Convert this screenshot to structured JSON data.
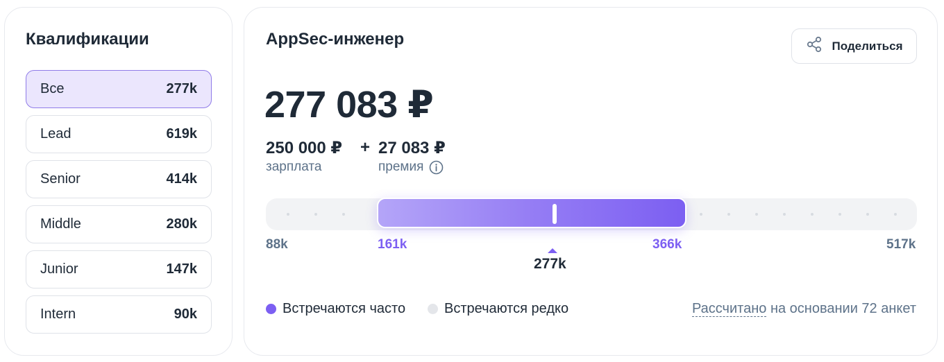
{
  "qualifications": {
    "title": "Квалификации",
    "items": [
      {
        "label": "Все",
        "value": "277k",
        "active": true
      },
      {
        "label": "Lead",
        "value": "619k"
      },
      {
        "label": "Senior",
        "value": "414k"
      },
      {
        "label": "Middle",
        "value": "280k"
      },
      {
        "label": "Junior",
        "value": "147k"
      },
      {
        "label": "Intern",
        "value": "90k"
      }
    ]
  },
  "role": {
    "title": "AppSec-инженер",
    "share_label": "Поделиться",
    "total": "277 083 ₽",
    "salary_value": "250 000 ₽",
    "plus": "+",
    "bonus_value": "27 083 ₽",
    "salary_caption": "зарплата",
    "bonus_caption": "премия"
  },
  "range": {
    "min": "88k",
    "p_low": "161k",
    "median": "277k",
    "p_high": "366k",
    "max": "517k"
  },
  "legend": {
    "frequent": "Встречаются часто",
    "rare": "Встречаются редко",
    "frequent_color": "#7c5ff2",
    "rare_color": "#e4e6ea"
  },
  "basis": {
    "link": "Рассчитано",
    "rest": " на основании 72 анкет"
  },
  "colors": {
    "accent": "#7c5ff2",
    "active_bg": "#ebe6fd",
    "muted_text": "#5d7289"
  },
  "icons": {
    "share": "share-icon",
    "info": "info-icon"
  }
}
